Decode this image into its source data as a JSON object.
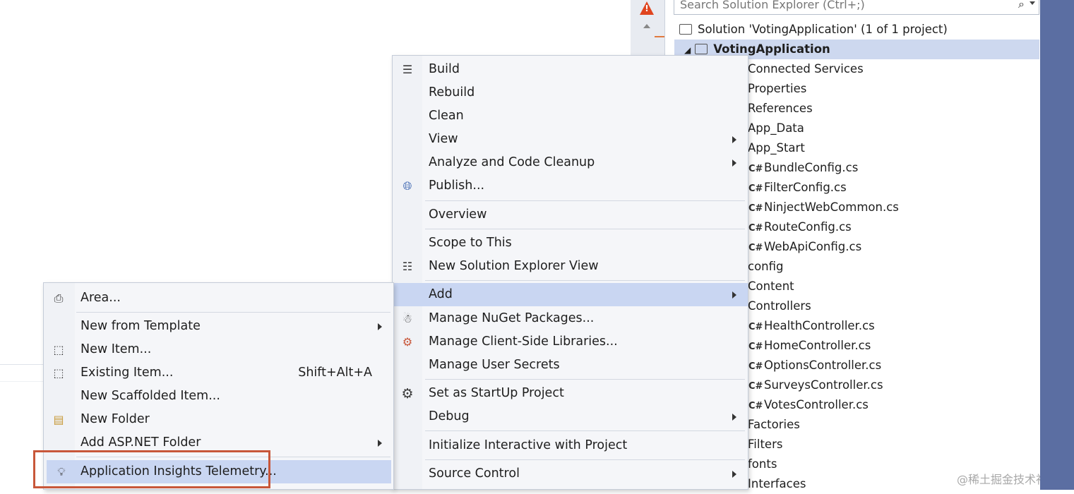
{
  "solution_explorer": {
    "search_placeholder": "Search Solution Explorer (Ctrl+;)",
    "solution_label": "Solution 'VotingApplication' (1 of 1 project)",
    "project_label": "VotingApplication",
    "items": [
      {
        "label": "Connected Services",
        "cs": false
      },
      {
        "label": "Properties",
        "cs": false
      },
      {
        "label": "References",
        "cs": false
      },
      {
        "label": "App_Data",
        "cs": false
      },
      {
        "label": "App_Start",
        "cs": false
      },
      {
        "label": "BundleConfig.cs",
        "cs": true
      },
      {
        "label": "FilterConfig.cs",
        "cs": true
      },
      {
        "label": "NinjectWebCommon.cs",
        "cs": true
      },
      {
        "label": "RouteConfig.cs",
        "cs": true
      },
      {
        "label": "WebApiConfig.cs",
        "cs": true
      },
      {
        "label": "config",
        "cs": false
      },
      {
        "label": "Content",
        "cs": false
      },
      {
        "label": "Controllers",
        "cs": false
      },
      {
        "label": "HealthController.cs",
        "cs": true
      },
      {
        "label": "HomeController.cs",
        "cs": true
      },
      {
        "label": "OptionsController.cs",
        "cs": true
      },
      {
        "label": "SurveysController.cs",
        "cs": true
      },
      {
        "label": "VotesController.cs",
        "cs": true
      },
      {
        "label": "Factories",
        "cs": false
      },
      {
        "label": "Filters",
        "cs": false
      },
      {
        "label": "fonts",
        "cs": false
      },
      {
        "label": "Interfaces",
        "cs": false
      }
    ]
  },
  "context_menu": {
    "build": "Build",
    "rebuild": "Rebuild",
    "clean": "Clean",
    "view": "View",
    "analyze": "Analyze and Code Cleanup",
    "publish": "Publish...",
    "overview": "Overview",
    "scope": "Scope to This",
    "new_se_view": "New Solution Explorer View",
    "add": "Add",
    "nuget": "Manage NuGet Packages...",
    "client_libs": "Manage Client-Side Libraries...",
    "user_secrets": "Manage User Secrets",
    "startup": "Set as StartUp Project",
    "debug": "Debug",
    "interactive": "Initialize Interactive with Project",
    "source_control": "Source Control"
  },
  "add_submenu": {
    "area": "Area...",
    "new_from_template": "New from Template",
    "new_item": "New Item...",
    "existing_item": "Existing Item...",
    "existing_item_shortcut": "Shift+Alt+A",
    "scaffolded": "New Scaffolded Item...",
    "new_folder": "New Folder",
    "aspnet_folder": "Add ASP.NET Folder",
    "app_insights": "Application Insights Telemetry..."
  },
  "cs_glyph": "C#",
  "warning_glyph": "!",
  "watermark": "@稀土掘金技术社区",
  "colors": {
    "menu_highlight": "#c9d6f2",
    "selection": "#cdd8ef",
    "callout_border": "#c8573a",
    "frame_blue": "#5b6ea2"
  }
}
